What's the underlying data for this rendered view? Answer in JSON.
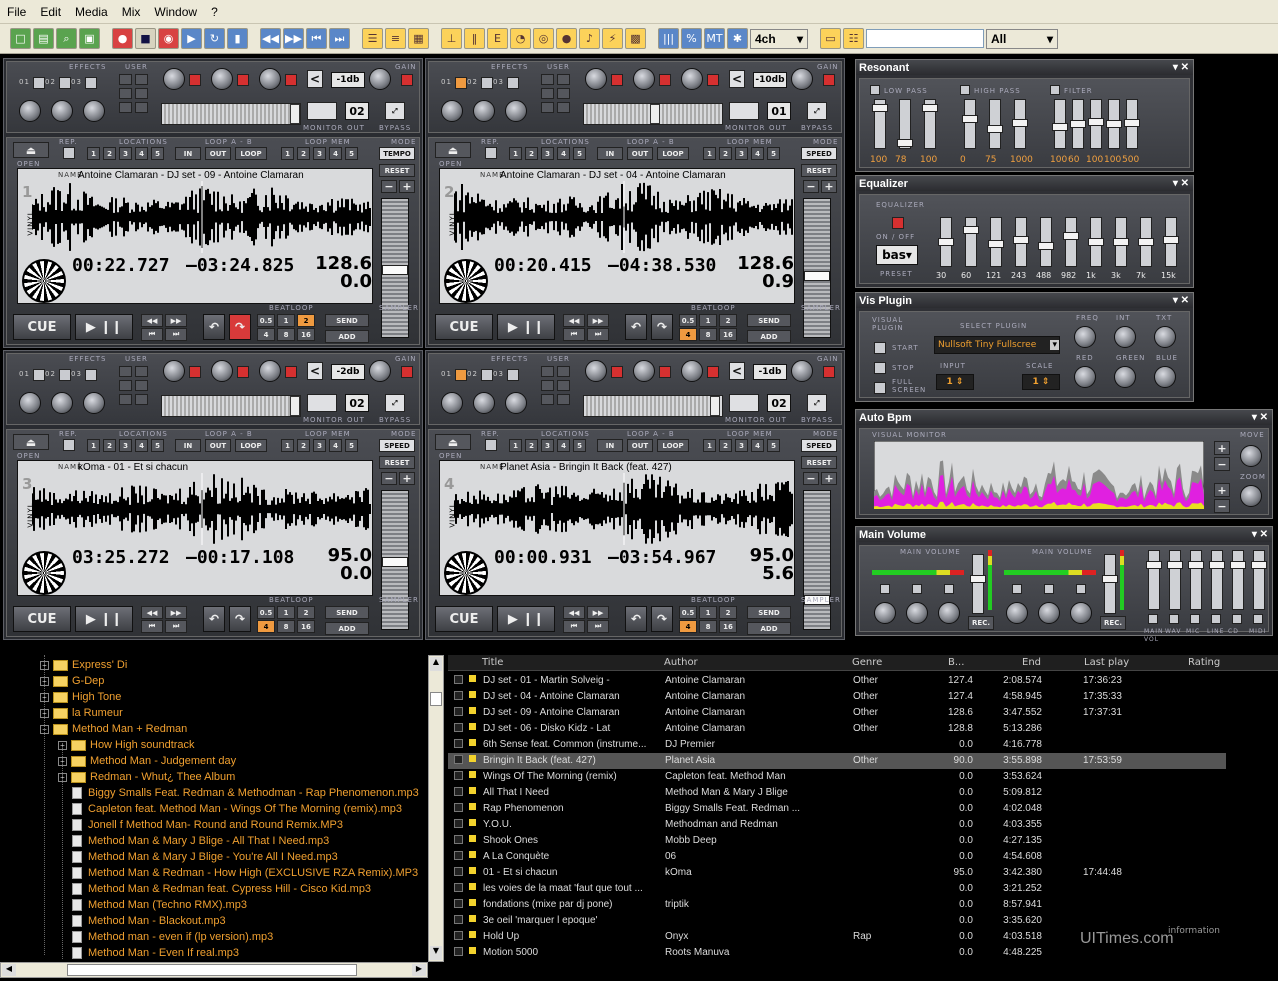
{
  "menu": [
    "File",
    "Edit",
    "Media",
    "Mix",
    "Window",
    "?"
  ],
  "toolbar": {
    "channels": "4ch",
    "filter": "All",
    "search_value": ""
  },
  "decks": [
    {
      "num": "1",
      "title": "Antoine Clamaran - DJ set - 09 - Antoine Clamaran",
      "gain": "-1db",
      "out": "02",
      "time": "00:22.727",
      "left": "–03:24.825",
      "bpm": "128.6",
      "pitch": "0.0",
      "mode": "TEMPO"
    },
    {
      "num": "2",
      "title": "Antoine Clamaran - DJ set - 04 - Antoine Clamaran",
      "gain": "-10db",
      "out": "01",
      "time": "00:20.415",
      "left": "–04:38.530",
      "bpm": "128.6",
      "pitch": "0.9",
      "mode": "SPEED"
    },
    {
      "num": "3",
      "title": "kOma - 01 - Et si chacun",
      "gain": "-2db",
      "out": "02",
      "time": "03:25.272",
      "left": "–00:17.108",
      "bpm": "95.0",
      "pitch": "0.0",
      "mode": "SPEED"
    },
    {
      "num": "4",
      "title": "Planet Asia - Bringin It Back (feat. 427)",
      "gain": "-1db",
      "out": "02",
      "time": "00:00.931",
      "left": "–03:54.967",
      "bpm": "95.0",
      "pitch": "5.6",
      "mode": "SPEED"
    }
  ],
  "deck_labels": {
    "effects": "EFFECTS",
    "user": "USER",
    "gain": "GAIN",
    "monitor": "MONITOR",
    "out": "OUT",
    "bypass": "BYPASS",
    "open": "OPEN",
    "rep": "REP.",
    "locations": "LOCATIONS",
    "loop_ab": "LOOP A - B",
    "loop_mem": "LOOP MEM",
    "mode": "MODE",
    "reset": "RESET",
    "in": "IN",
    "outb": "OUT",
    "loop": "LOOP",
    "name": "NAME",
    "vinyl": "VINYL",
    "cue": "CUE",
    "beatloop": "BEATLOOP",
    "sampler": "SAMPLER",
    "send": "SEND",
    "add": "ADD",
    "fx": [
      "01",
      "02",
      "03"
    ],
    "loc": [
      "1",
      "2",
      "3",
      "4",
      "5"
    ],
    "bl": [
      "0.5",
      "1",
      "2",
      "4",
      "8",
      "16"
    ]
  },
  "resonant": {
    "title": "Resonant",
    "groups": [
      "LOW PASS",
      "HIGH PASS",
      "FILTER"
    ],
    "values": [
      "100",
      "78",
      "100",
      "0",
      "75",
      "1000",
      "100",
      "60",
      "100",
      "100",
      "500"
    ]
  },
  "equalizer": {
    "title": "Equalizer",
    "label": "EQUALIZER",
    "onoff": "ON / OFF",
    "preset": "bas",
    "preset_label": "PRESET",
    "bands": [
      "30",
      "60",
      "121",
      "243",
      "488",
      "982",
      "1k",
      "3k",
      "7k",
      "15k"
    ]
  },
  "vis": {
    "title": "Vis Plugin",
    "visual": "VISUAL PLUGIN",
    "select": "SELECT PLUGIN",
    "plugin": "Nullsoft Tiny Fullscree",
    "start": "START",
    "stop": "STOP",
    "full": "FULL SCREEN",
    "input_label": "INPUT",
    "input": "1",
    "scale_label": "SCALE",
    "scale": "1",
    "knobs": [
      "FREQ",
      "INT",
      "TXT",
      "RED",
      "GREEN",
      "BLUE"
    ]
  },
  "autobpm": {
    "title": "Auto Bpm",
    "monitor": "VISUAL MONITOR",
    "move": "MOVE",
    "zoom": "ZOOM"
  },
  "mainvol": {
    "title": "Main Volume",
    "label": "MAIN VOLUME",
    "rec": "REC.",
    "ch": [
      "MAIN",
      "WAV",
      "MIC",
      "LINE",
      "CD",
      "MIDI"
    ],
    "vol": "VOL"
  },
  "tree": [
    {
      "d": 2,
      "t": "folder",
      "name": "Express' Di"
    },
    {
      "d": 2,
      "t": "folder",
      "name": "G-Dep"
    },
    {
      "d": 2,
      "t": "folder",
      "name": "High Tone"
    },
    {
      "d": 2,
      "t": "folder",
      "name": "la Rumeur"
    },
    {
      "d": 2,
      "t": "open",
      "name": "Method Man + Redman"
    },
    {
      "d": 3,
      "t": "folder",
      "name": "How High soundtrack"
    },
    {
      "d": 3,
      "t": "folder",
      "name": "Method Man - Judgement day"
    },
    {
      "d": 3,
      "t": "folder",
      "name": "Redman - Whut¿ Thee Album"
    },
    {
      "d": 3,
      "t": "file",
      "name": "Biggy Smalls Feat. Redman & Methodman - Rap Phenomenon.mp3"
    },
    {
      "d": 3,
      "t": "file",
      "name": "Capleton feat. Method Man - Wings Of The Morning (remix).mp3"
    },
    {
      "d": 3,
      "t": "file",
      "name": "Jonell f Method Man- Round and Round Remix.MP3"
    },
    {
      "d": 3,
      "t": "file",
      "name": "Method Man & Mary J Blige - All That I Need.mp3"
    },
    {
      "d": 3,
      "t": "file",
      "name": "Method Man & Mary J Blige - You're All I Need.mp3"
    },
    {
      "d": 3,
      "t": "file",
      "name": "Method Man & Redman - How High (EXCLUSIVE RZA Remix).MP3"
    },
    {
      "d": 3,
      "t": "file",
      "name": "Method Man & Redman feat. Cypress Hill - Cisco Kid.mp3"
    },
    {
      "d": 3,
      "t": "file",
      "name": "Method Man (Techno RMX).mp3"
    },
    {
      "d": 3,
      "t": "file",
      "name": "Method Man - Blackout.mp3"
    },
    {
      "d": 3,
      "t": "file",
      "name": "Method man - even if (lp version).mp3"
    },
    {
      "d": 3,
      "t": "file",
      "name": "Method Man - Even If real.mp3"
    }
  ],
  "playlist": {
    "columns": [
      "Title",
      "Author",
      "Genre",
      "B...",
      "End",
      "Last play",
      "Rating"
    ],
    "rows": [
      {
        "title": "DJ set - 01 - Martin Solveig -",
        "author": "Antoine Clamaran",
        "genre": "Other",
        "bpm": "127.4",
        "end": "2:08.574",
        "last": "17:36:23"
      },
      {
        "title": "DJ set - 04 - Antoine Clamaran",
        "author": "Antoine Clamaran",
        "genre": "Other",
        "bpm": "127.4",
        "end": "4:58.945",
        "last": "17:35:33"
      },
      {
        "title": "DJ set - 09 - Antoine Clamaran",
        "author": "Antoine Clamaran",
        "genre": "Other",
        "bpm": "128.6",
        "end": "3:47.552",
        "last": "17:37:31"
      },
      {
        "title": "DJ set - 06 - Disko Kidz - Lat",
        "author": "Antoine Clamaran",
        "genre": "Other",
        "bpm": "128.8",
        "end": "5:13.286",
        "last": ""
      },
      {
        "title": "6th Sense feat. Common (instrume...",
        "author": "DJ Premier",
        "genre": "",
        "bpm": "0.0",
        "end": "4:16.778",
        "last": ""
      },
      {
        "title": "Bringin It Back (feat. 427)",
        "author": "Planet Asia",
        "genre": "Other",
        "bpm": "90.0",
        "end": "3:55.898",
        "last": "17:53:59",
        "sel": true
      },
      {
        "title": "Wings Of The Morning (remix)",
        "author": "Capleton feat. Method Man",
        "genre": "",
        "bpm": "0.0",
        "end": "3:53.624",
        "last": ""
      },
      {
        "title": "All That I Need",
        "author": "Method Man & Mary J Blige",
        "genre": "",
        "bpm": "0.0",
        "end": "5:09.812",
        "last": ""
      },
      {
        "title": "Rap Phenomenon",
        "author": "Biggy Smalls Feat. Redman ...",
        "genre": "",
        "bpm": "0.0",
        "end": "4:02.048",
        "last": ""
      },
      {
        "title": "Y.O.U.",
        "author": "Methodman and Redman",
        "genre": "",
        "bpm": "0.0",
        "end": "4:03.355",
        "last": ""
      },
      {
        "title": "Shook Ones",
        "author": "Mobb Deep",
        "genre": "",
        "bpm": "0.0",
        "end": "4:27.135",
        "last": ""
      },
      {
        "title": "A La Conquète",
        "author": "06",
        "genre": "",
        "bpm": "0.0",
        "end": "4:54.608",
        "last": ""
      },
      {
        "title": "01 - Et si chacun",
        "author": "kOma",
        "genre": "",
        "bpm": "95.0",
        "end": "3:42.380",
        "last": "17:44:48"
      },
      {
        "title": "les voies de la maat 'faut que tout ...",
        "author": "",
        "genre": "",
        "bpm": "0.0",
        "end": "3:21.252",
        "last": ""
      },
      {
        "title": "fondations (mixe par dj pone)",
        "author": "triptik",
        "genre": "",
        "bpm": "0.0",
        "end": "8:57.941",
        "last": ""
      },
      {
        "title": "3e oeil 'marquer l epoque'",
        "author": "",
        "genre": "",
        "bpm": "0.0",
        "end": "3:35.620",
        "last": ""
      },
      {
        "title": "Hold Up",
        "author": "Onyx",
        "genre": "Rap",
        "bpm": "0.0",
        "end": "4:03.518",
        "last": ""
      },
      {
        "title": "Motion 5000",
        "author": "Roots Manuva",
        "genre": "",
        "bpm": "0.0",
        "end": "4:48.225",
        "last": ""
      }
    ]
  },
  "watermark": "UITimes.com",
  "watermark_sub": "information"
}
